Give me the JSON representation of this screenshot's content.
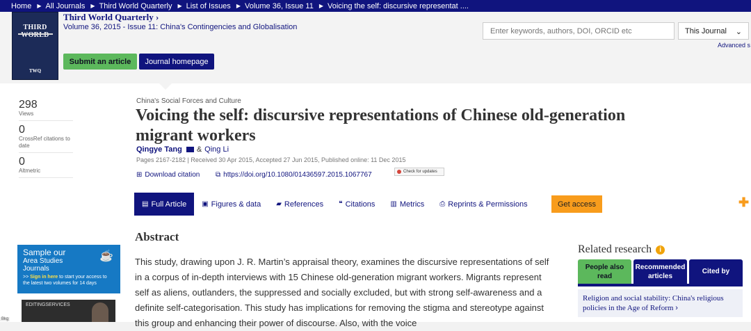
{
  "breadcrumb": [
    "Home",
    "All Journals",
    "Third World Quarterly",
    "List of Issues",
    "Volume 36, Issue 11",
    "Voicing the self: discursive representat ...."
  ],
  "journal": {
    "cover_title": "THIRD WORLD",
    "cover_badge": "TWQ",
    "title": "Third World Quarterly",
    "issue": "Volume 36, 2015 - Issue 11: China's Contingencies and Globalisation",
    "submit_label": "Submit an article",
    "home_label": "Journal homepage"
  },
  "search": {
    "placeholder": "Enter keywords, authors, DOI, ORCID etc",
    "scope": "This Journal",
    "advanced": "Advanced s"
  },
  "metrics": [
    {
      "value": "298",
      "label": "Views"
    },
    {
      "value": "0",
      "label": "CrossRef citations to date"
    },
    {
      "value": "0",
      "label": "Altmetric"
    }
  ],
  "article": {
    "section": "China's Social Forces and Culture",
    "title": "Voicing the self: discursive representations of Chinese old-generation migrant workers",
    "author1": "Qingye Tang",
    "amp": "&",
    "author2": "Qing Li",
    "pages": "Pages 2167-2182 | Received 30 Apr 2015, Accepted 27 Jun 2015, Published online: 11 Dec 2015",
    "download": "Download citation",
    "doi": "https://doi.org/10.1080/01436597.2015.1067767",
    "updates": "Check for updates"
  },
  "tabs": [
    {
      "label": "Full Article",
      "icon": "file-icon"
    },
    {
      "label": "Figures & data",
      "icon": "image-icon"
    },
    {
      "label": "References",
      "icon": "book-icon"
    },
    {
      "label": "Citations",
      "icon": "quote-icon"
    },
    {
      "label": "Metrics",
      "icon": "chart-icon"
    },
    {
      "label": "Reprints & Permissions",
      "icon": "print-icon"
    }
  ],
  "get_access": "Get access",
  "abstract": {
    "heading": "Abstract",
    "text": "This study, drawing upon J. R. Martin’s appraisal theory, examines the discursive representations of self in a corpus of in-depth interviews with 15 Chinese old-generation migrant workers. Migrants represent self as aliens, outlanders, the suppressed and socially excluded, but with strong self-awareness and a definite self-categorisation. This study has implications for removing the stigma and stereotype against this group and enhancing their power of discourse. Also, with the voice"
  },
  "promo": {
    "line1": "Sample our",
    "line2": "Area Studies",
    "line3": "Journals",
    "cta_prefix": ">>",
    "cta_link": "Sign in here",
    "cta_rest": "to start your access to the latest two volumes for 14 days",
    "banner2": "EDITINGSERVICES",
    "bottom_label": "Bkg"
  },
  "related": {
    "heading": "Related research",
    "tabs": [
      "People also read",
      "Recommended articles",
      "Cited by"
    ],
    "item": "Religion and social stability: China's religious policies in the Age of Reform"
  },
  "colors": {
    "navy": "#10147e",
    "green": "#5cb85c",
    "orange": "#f89c1c",
    "blue": "#1679c4"
  }
}
